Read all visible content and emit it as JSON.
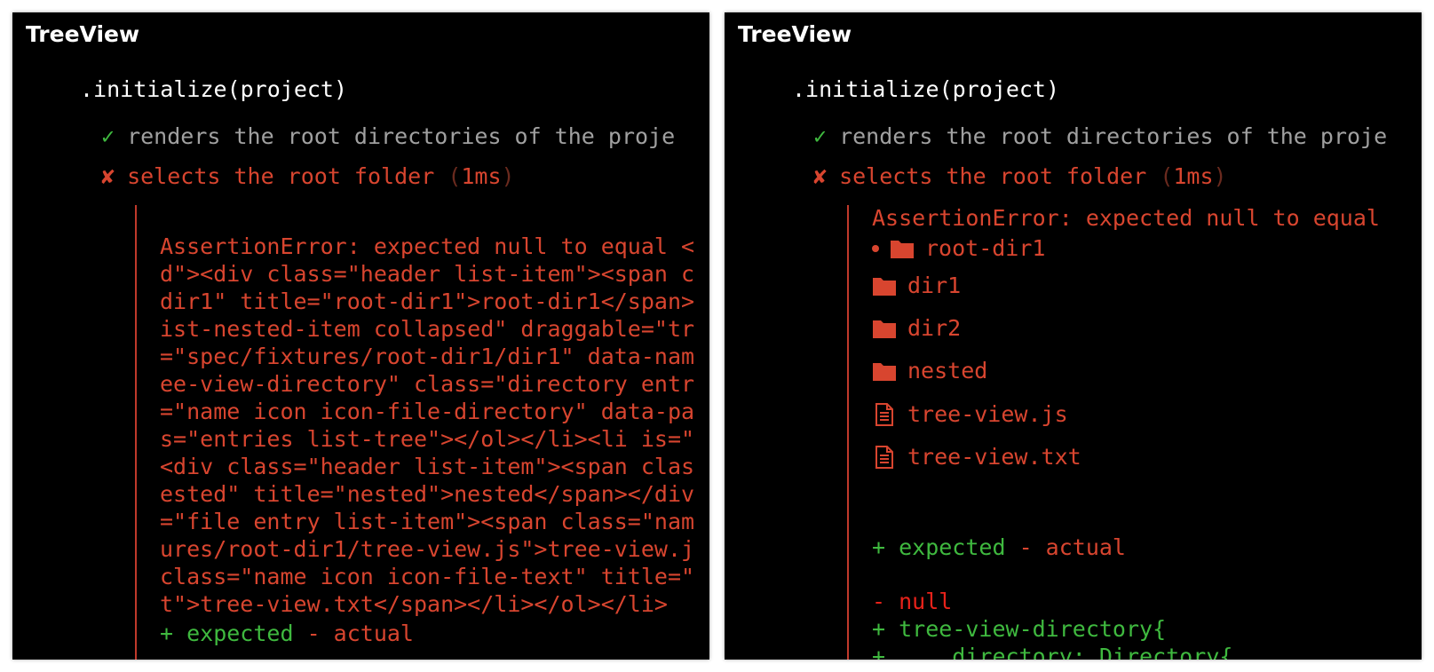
{
  "left_panel": {
    "suite_title": "TreeView",
    "describe_title": ".initialize(project)",
    "passing_test": "renders the root directories of the proje",
    "failing_test": "selects the root folder",
    "duration_open": "(",
    "duration": "1ms",
    "duration_close": ")",
    "error_lines": [
      "AssertionError: expected null to equal <",
      "d\"><div class=\"header list-item\"><span c",
      "dir1\" title=\"root-dir1\">root-dir1</span>",
      "ist-nested-item collapsed\" draggable=\"tr",
      "=\"spec/fixtures/root-dir1/dir1\" data-nam",
      "ee-view-directory\" class=\"directory entr",
      "=\"name icon icon-file-directory\" data-pa",
      "s=\"entries list-tree\"></ol></li><li is=\"",
      "<div class=\"header list-item\"><span clas",
      "ested\" title=\"nested\">nested</span></div",
      "=\"file entry list-item\"><span class=\"nam",
      "ures/root-dir1/tree-view.js\">tree-view.j",
      "class=\"name icon icon-file-text\" title=\"",
      "t\">tree-view.txt</span></li></ol></li>"
    ],
    "diff_plus": "+ expected",
    "diff_sep": " - ",
    "diff_minus": "actual"
  },
  "right_panel": {
    "suite_title": "TreeView",
    "describe_title": ".initialize(project)",
    "passing_test": "renders the root directories of the proje",
    "failing_test": "selects the root folder",
    "duration_open": "(",
    "duration": "1ms",
    "duration_close": ")",
    "error_prefix": "AssertionError:",
    "error_message": " expected null to equal",
    "tree": {
      "root": "root-dir1",
      "folders": [
        "dir1",
        "dir2",
        "nested"
      ],
      "files": [
        "tree-view.js",
        "tree-view.txt"
      ]
    },
    "diff_plus": "+ expected",
    "diff_sep": " - ",
    "diff_minus": "actual",
    "diff_lines": {
      "null_line": "- null",
      "added_line": "+ tree-view-directory{",
      "added_line_2": "+     directory: Directory{"
    }
  },
  "colors": {
    "background": "#000000",
    "pass": "#3fb93f",
    "fail": "#d8452f",
    "muted": "#a0a0a0"
  }
}
